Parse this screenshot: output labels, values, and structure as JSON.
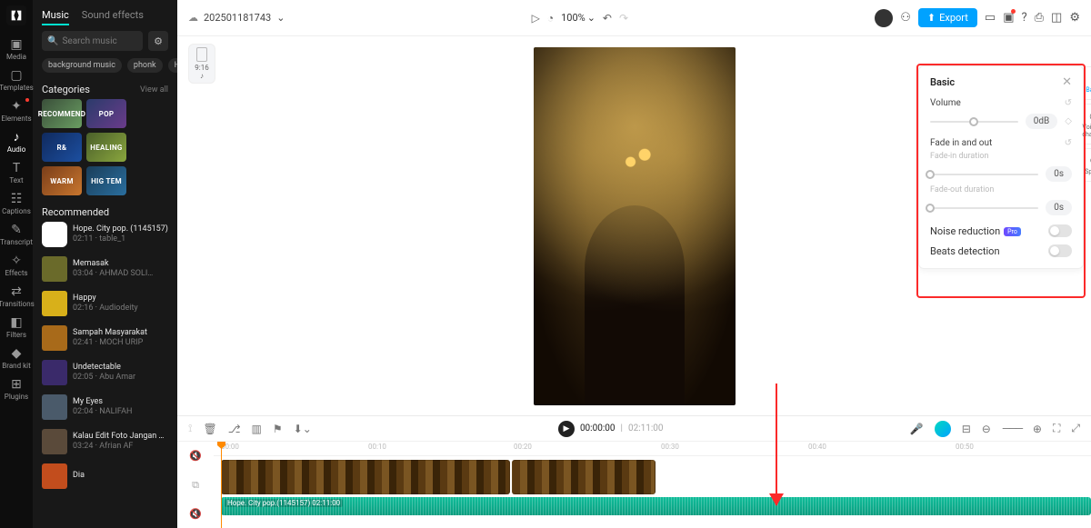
{
  "leftSidebar": {
    "items": [
      {
        "icon": "▣",
        "label": "Media"
      },
      {
        "icon": "▢",
        "label": "Templates"
      },
      {
        "icon": "✦",
        "label": "Elements",
        "badge": true
      },
      {
        "icon": "♪",
        "label": "Audio",
        "active": true
      },
      {
        "icon": "T",
        "label": "Text"
      },
      {
        "icon": "☷",
        "label": "Captions"
      },
      {
        "icon": "✎",
        "label": "Transcript"
      },
      {
        "icon": "✧",
        "label": "Effects"
      },
      {
        "icon": "⇄",
        "label": "Transitions"
      },
      {
        "icon": "◧",
        "label": "Filters"
      },
      {
        "icon": "◆",
        "label": "Brand kit"
      },
      {
        "icon": "⊞",
        "label": "Plugins"
      }
    ]
  },
  "musicPanel": {
    "tabs": {
      "music": "Music",
      "sfx": "Sound effects"
    },
    "searchPlaceholder": "Search music",
    "chips": [
      "background music",
      "phonk",
      "Hap"
    ],
    "categoriesLabel": "Categories",
    "viewAll": "View all",
    "categories": [
      "RECOMMEND",
      "POP",
      "R&",
      "HEALING",
      "WARM",
      "HIG TEM"
    ],
    "recommendedLabel": "Recommended",
    "tracks": [
      {
        "title": "Hope. City pop. (1145157)",
        "sub": "02:11 · table_1"
      },
      {
        "title": "Memasak",
        "sub": "03:04 · AHMAD SOLI…"
      },
      {
        "title": "Happy",
        "sub": "02:16 · Audiodeity"
      },
      {
        "title": "Sampah Masyarakat",
        "sub": "02:41 · MOCH URIP"
      },
      {
        "title": "Undetectable",
        "sub": "02:05 · Abu Amar"
      },
      {
        "title": "My Eyes",
        "sub": "02:04 · NALIFAH"
      },
      {
        "title": "Kalau Edit Foto Jangan Terlalu…",
        "sub": "03:24 · Afrian AF"
      },
      {
        "title": "Dia",
        "sub": ""
      }
    ]
  },
  "topbar": {
    "projectName": "202501181743",
    "zoom": "100%",
    "exportLabel": "Export"
  },
  "ratioChip": {
    "ratio": "9:16",
    "platform": "♪"
  },
  "rightPanel": {
    "title": "Basic",
    "tabs": [
      {
        "icon": "♪",
        "label": "Basic"
      },
      {
        "icon": "◎",
        "label": "Voice changer"
      },
      {
        "icon": "⊙",
        "label": "Speed"
      }
    ],
    "volumeLabel": "Volume",
    "volumeValue": "0dB",
    "fadeLabel": "Fade in and out",
    "fadeInLabel": "Fade-in duration",
    "fadeInValue": "0s",
    "fadeOutLabel": "Fade-out duration",
    "fadeOutValue": "0s",
    "noiseLabel": "Noise reduction",
    "proBadge": "Pro",
    "beatsLabel": "Beats detection"
  },
  "timeline": {
    "currentTime": "00:00:00",
    "totalTime": "02:11:00",
    "ruler": [
      "00:00",
      "00:10",
      "00:20",
      "00:30",
      "00:40",
      "00:50"
    ],
    "audioClipLabel": "Hope. City pop.(1145157)  02:11:00"
  }
}
